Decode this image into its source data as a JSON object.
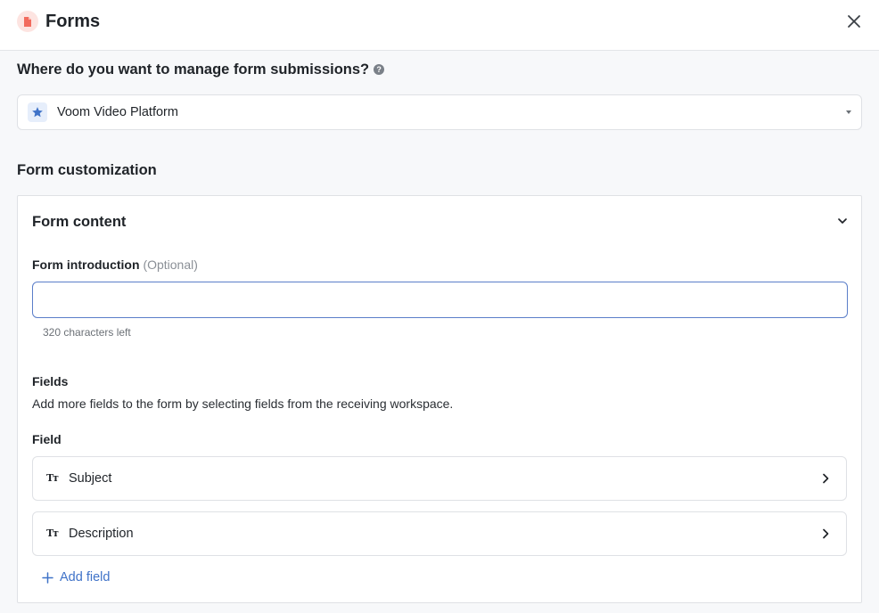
{
  "header": {
    "title": "Forms",
    "icon": "document-icon",
    "accent": "#f26b5e"
  },
  "question": {
    "text": "Where do you want to manage form submissions?",
    "help_icon": "?"
  },
  "workspace_select": {
    "value": "Voom Video Platform",
    "icon": "star-icon",
    "icon_color": "#3f72c8"
  },
  "customization": {
    "title": "Form customization"
  },
  "form_content": {
    "title": "Form content",
    "intro_label": "Form introduction",
    "intro_optional": "(Optional)",
    "intro_value": "",
    "counter": "320 characters left",
    "fields_title": "Fields",
    "fields_desc": "Add more fields to the form by selecting fields from the receiving workspace.",
    "field_label": "Field",
    "fields": [
      {
        "type_glyph": "Tт",
        "name": "Subject"
      },
      {
        "type_glyph": "Tт",
        "name": "Description"
      }
    ],
    "add_field": "Add field"
  }
}
